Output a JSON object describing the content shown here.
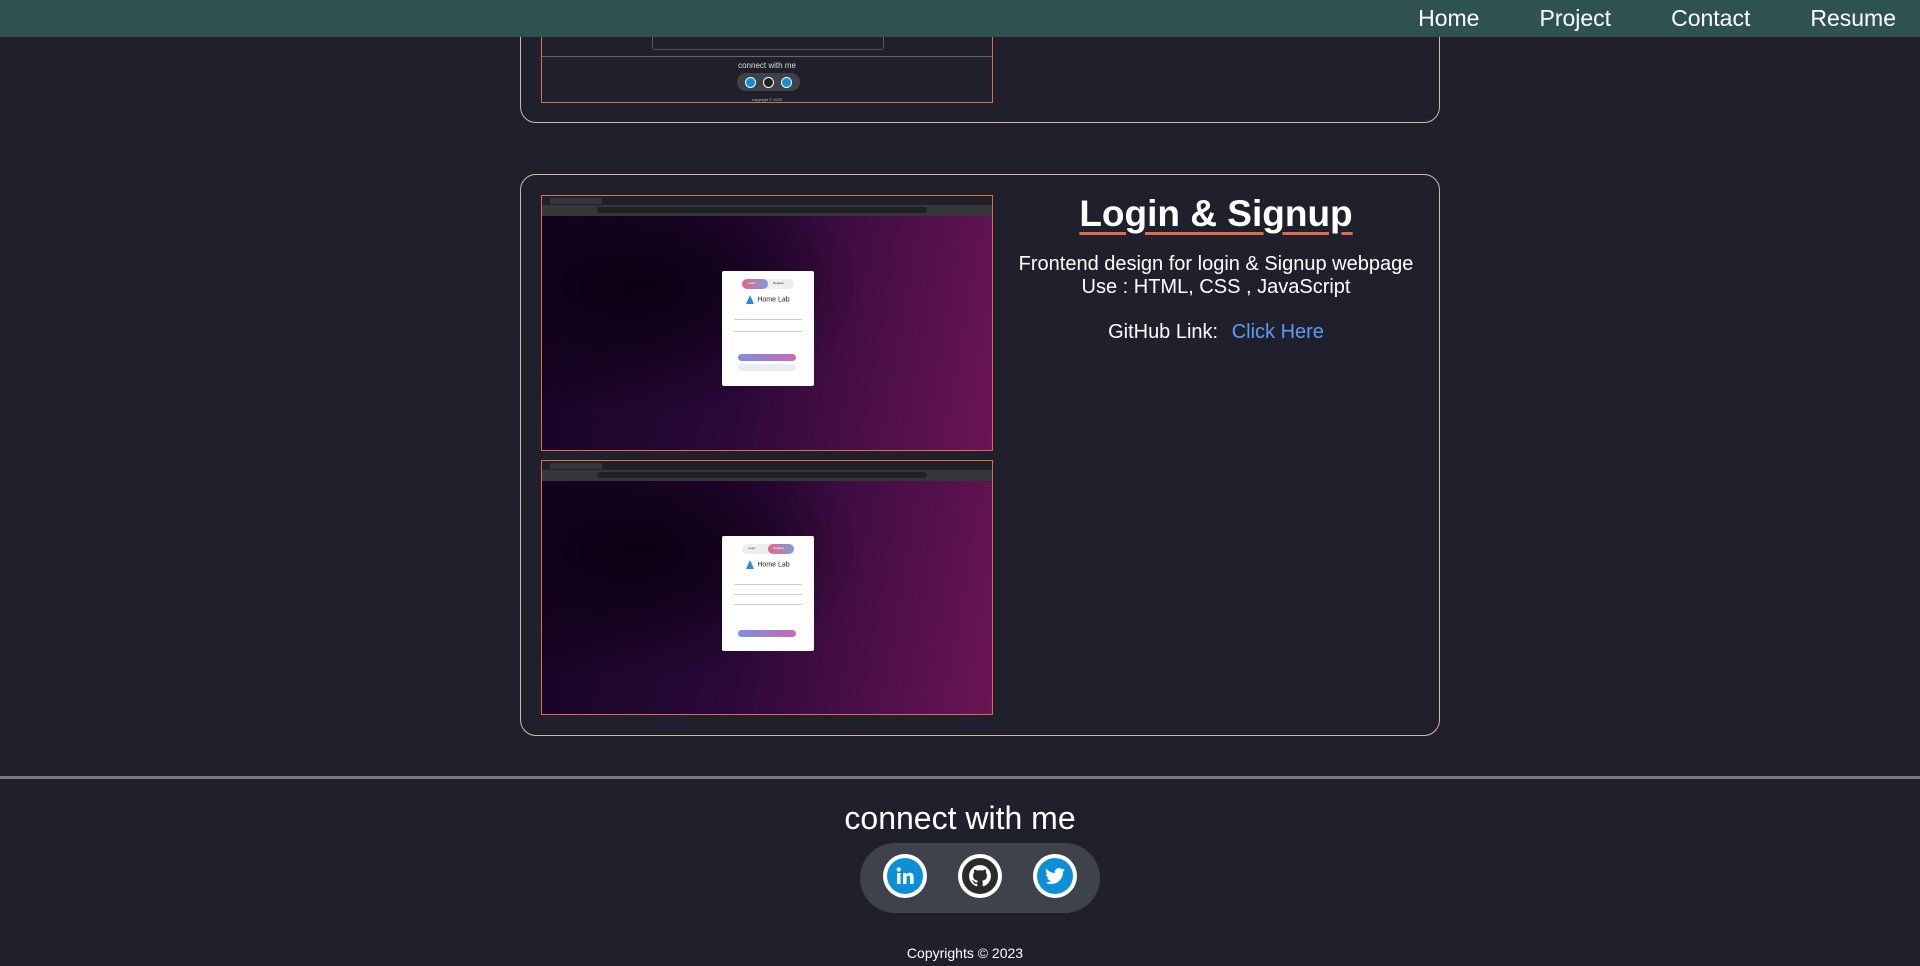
{
  "nav": {
    "items": [
      "Home",
      "Project",
      "Contact",
      "Resume"
    ]
  },
  "project_prev": {
    "connect": "connect with me",
    "copyright": "copyright © 2023"
  },
  "project": {
    "title": "Login & Signup",
    "desc_line1": "Frontend design for login & Signup webpage",
    "desc_line2": "Use : HTML, CSS , JavaScript",
    "github_label": "GitHub Link:",
    "github_link": "Click Here",
    "preview_login": {
      "tab_login": "Login",
      "tab_signup": "Register",
      "brand": "Home Lab"
    },
    "preview_signup": {
      "tab_login": "Login",
      "tab_signup": "Register",
      "brand": "Home Lab"
    }
  },
  "footer": {
    "connect": "connect with me",
    "social": [
      "linkedin",
      "github",
      "twitter"
    ],
    "copyright": "Copyrights © 2023"
  },
  "colors": {
    "nav": "#2e5252",
    "bg": "#1f202b",
    "accent": "#e16b4f",
    "link": "#5b9cf2",
    "social": "#0b8fd6"
  }
}
